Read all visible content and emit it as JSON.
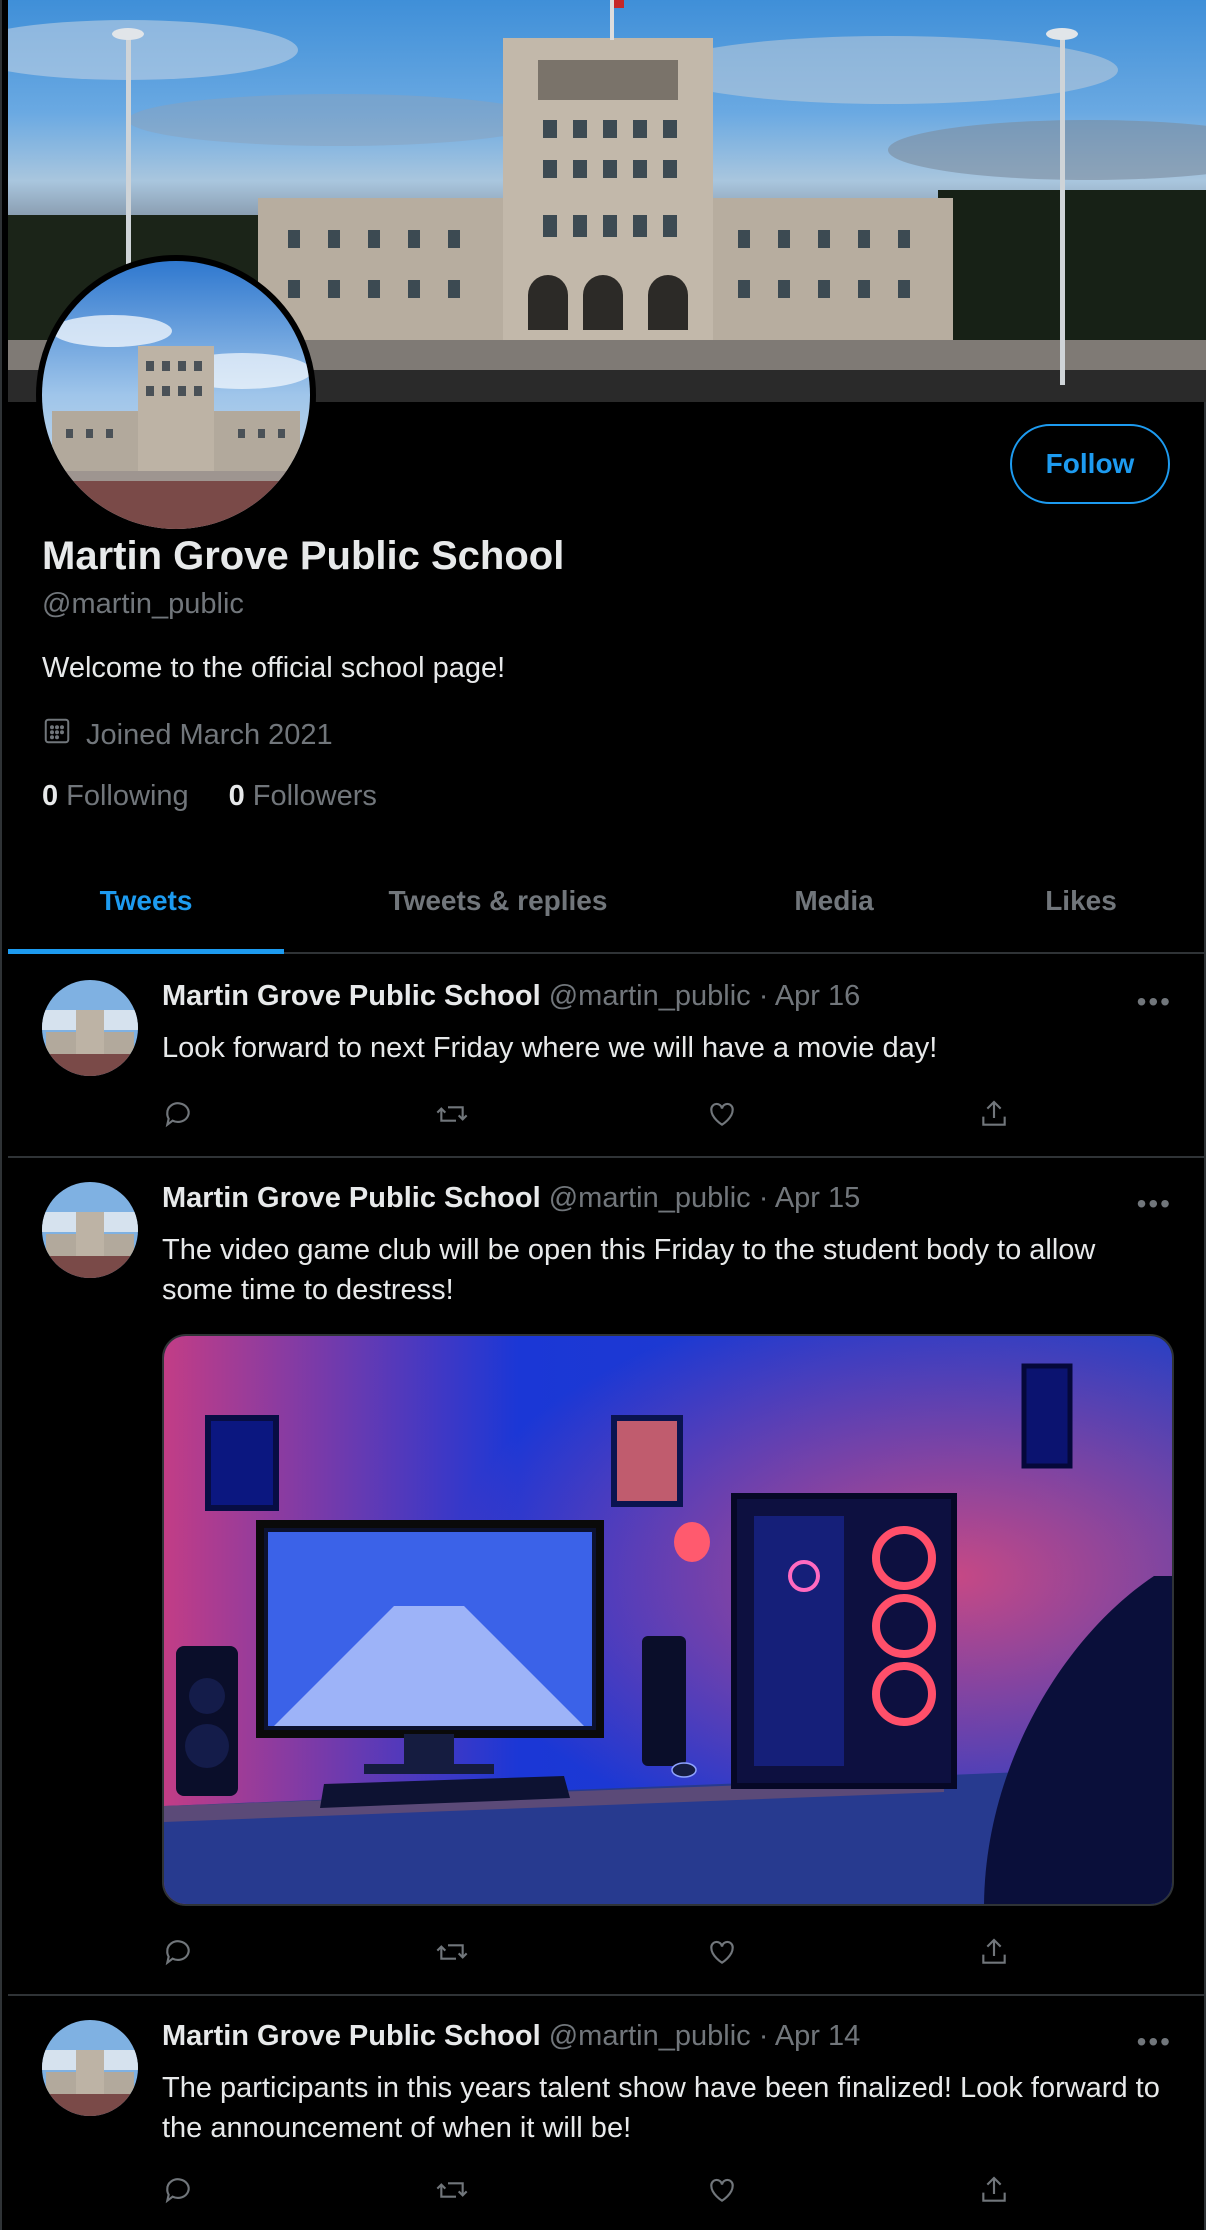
{
  "profile": {
    "name": "Martin Grove Public School",
    "handle": "@martin_public",
    "bio": "Welcome to the official school page!",
    "joined": "Joined March 2021",
    "following_count": "0",
    "following_label": "Following",
    "followers_count": "0",
    "followers_label": "Followers",
    "follow_label": "Follow"
  },
  "tabs": [
    {
      "label": "Tweets",
      "active": true
    },
    {
      "label": "Tweets & replies",
      "active": false
    },
    {
      "label": "Media",
      "active": false
    },
    {
      "label": "Likes",
      "active": false
    }
  ],
  "tweets": [
    {
      "name": "Martin Grove Public School",
      "meta": "@martin_public · Apr 16",
      "text": "Look forward to next Friday where we will have a movie day!",
      "more": "•••"
    },
    {
      "name": "Martin Grove Public School",
      "meta": "@martin_public · Apr 15",
      "text": "The video game club will be open this Friday to the student body to allow some time to destress!",
      "more": "•••"
    },
    {
      "name": "Martin Grove Public School",
      "meta": "@martin_public · Apr 14",
      "text": "The participants in this years talent show have been finalized! Look forward to the announcement of when it will be!",
      "more": "•••"
    }
  ],
  "icons": [
    "calendar-icon",
    "reply-icon",
    "retweet-icon",
    "like-icon",
    "share-icon",
    "more-icon"
  ],
  "colors": {
    "accent": "#1d9bf0",
    "muted": "#71767b",
    "text": "#e7e9ea",
    "border": "#2f3336"
  }
}
